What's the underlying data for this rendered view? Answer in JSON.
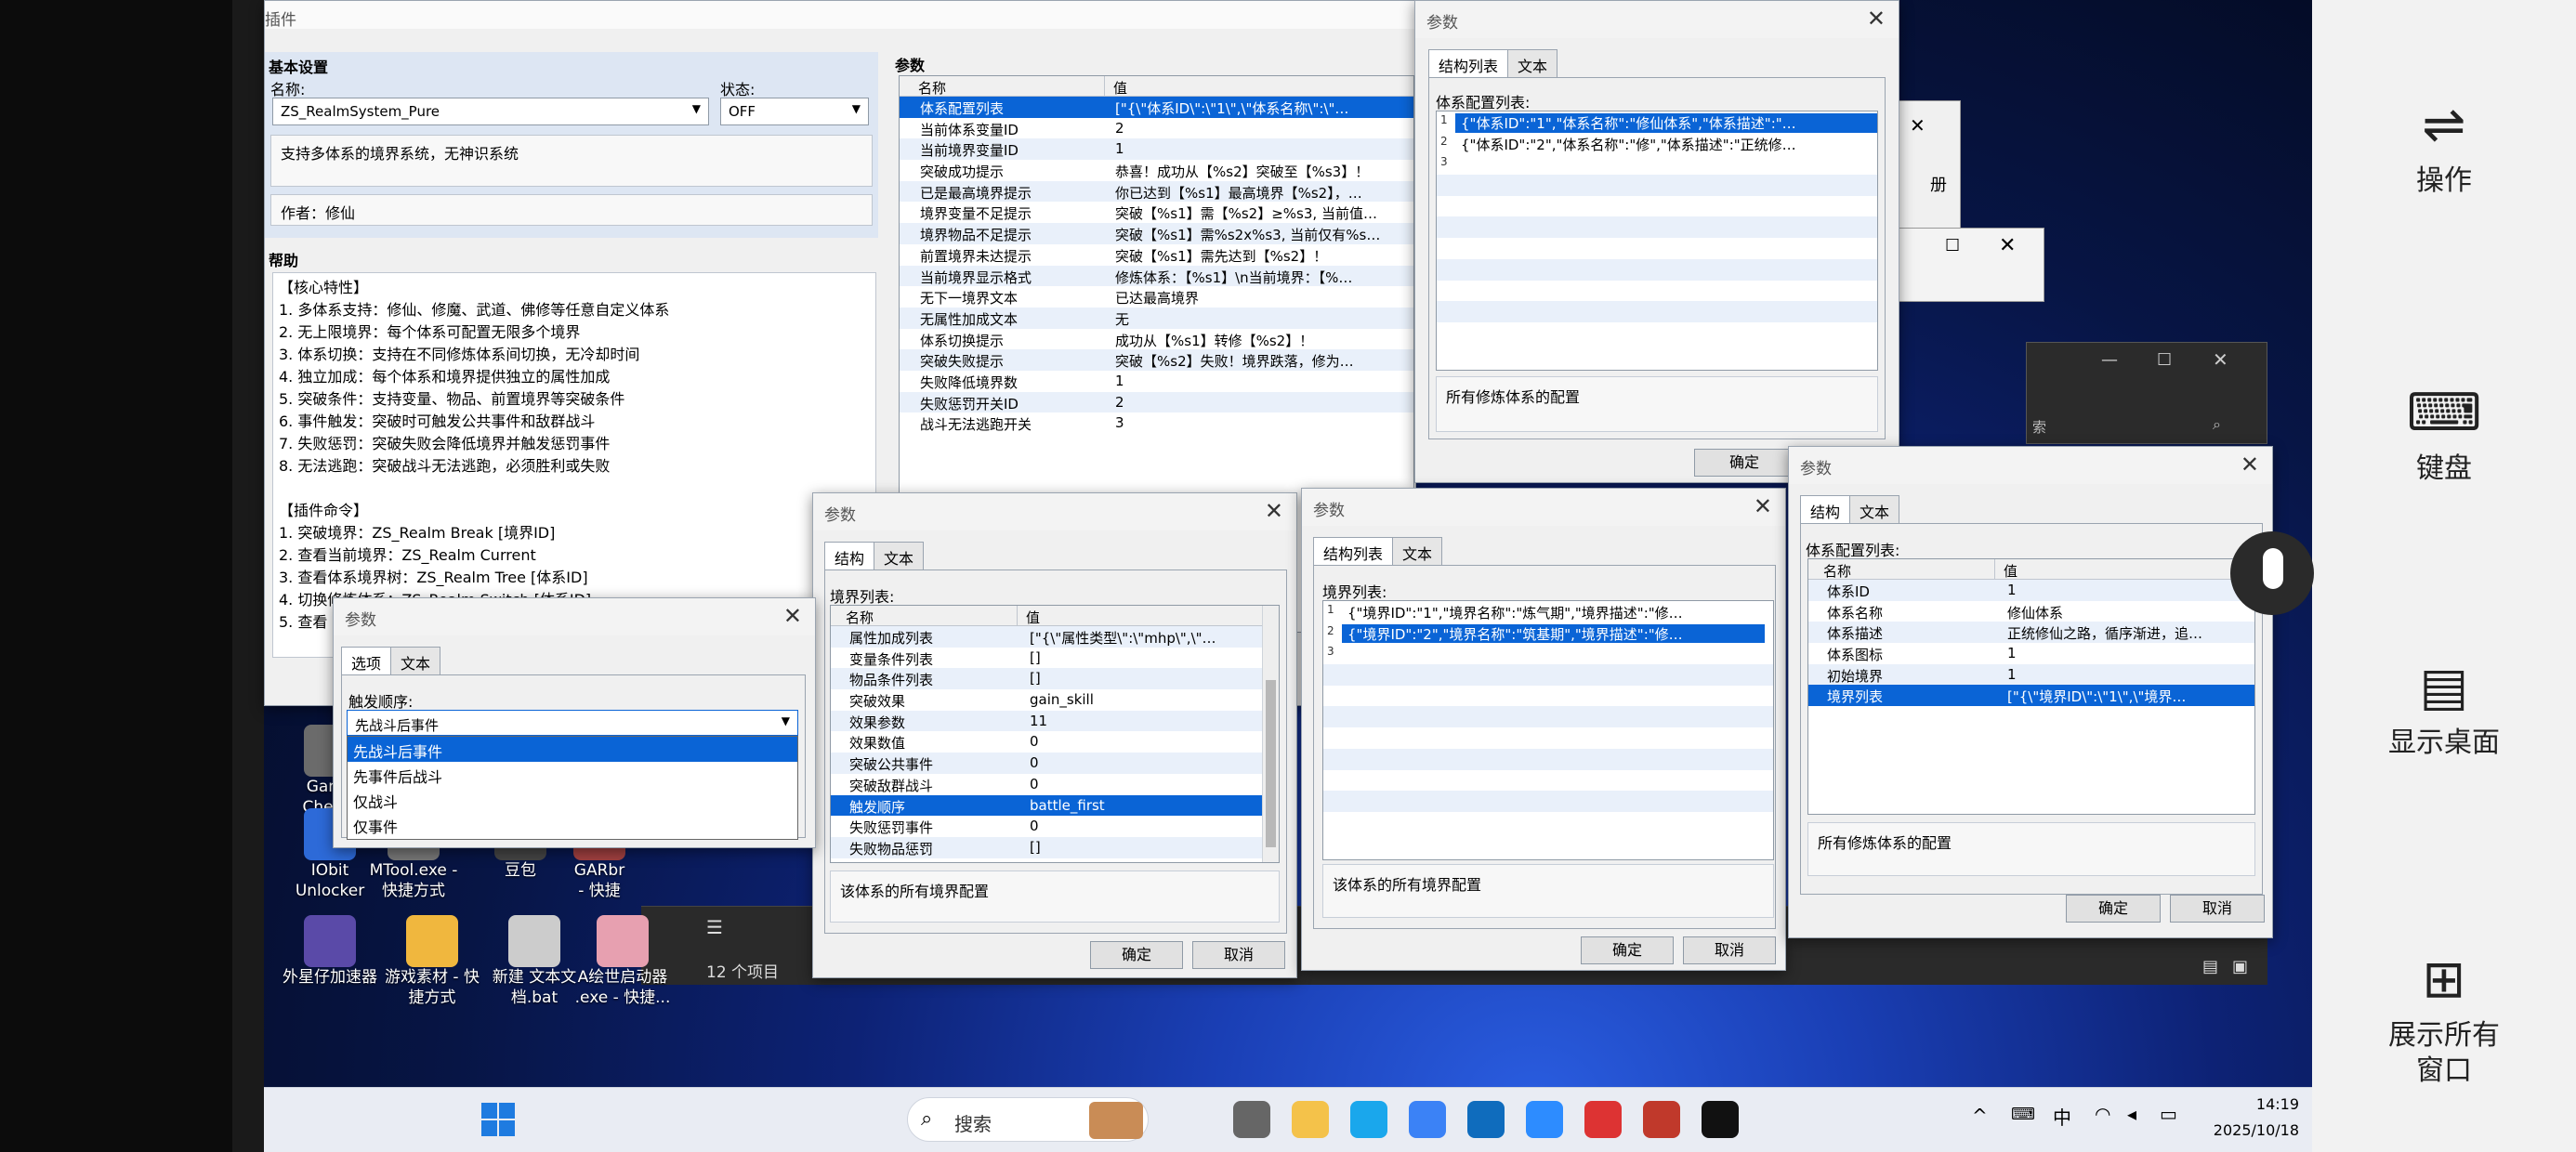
{
  "right_panel": {
    "items": [
      {
        "label": "操作",
        "icon": "toggle-icon"
      },
      {
        "label": "键盘",
        "icon": "keyboard-icon"
      },
      {
        "label": "显示桌面",
        "icon": "desktop-icon"
      },
      {
        "label": "展示所有窗口",
        "icon": "windows-grid-icon"
      }
    ]
  },
  "plugin_window": {
    "title": "插件",
    "basic_settings": "基本设置",
    "name_label": "名称:",
    "name_value": "ZS_RealmSystem_Pure",
    "status_label": "状态:",
    "status_value": "OFF",
    "description": "支持多体系的境界系统，无神识系统",
    "author": "作者：修仙",
    "help_label": "帮助",
    "help_lines": [
      "【核心特性】",
      "1. 多体系支持：修仙、修魔、武道、佛修等任意自定义体系",
      "2. 无上限境界：每个体系可配置无限多个境界",
      "3. 体系切换：支持在不同修炼体系间切换，无冷却时间",
      "4. 独立加成：每个体系和境界提供独立的属性加成",
      "5. 突破条件：支持变量、物品、前置境界等突破条件",
      "6. 事件触发：突破时可触发公共事件和敌群战斗",
      "7. 失败惩罚：突破失败会降低境界并触发惩罚事件",
      "8. 无法逃跑：突破战斗无法逃跑，必须胜利或失败",
      "",
      "【插件命令】",
      "1. 突破境界：ZS_Realm Break [境界ID]",
      "2. 查看当前境界：ZS_Realm Current",
      "3. 查看体系境界树：ZS_Realm Tree [体系ID]",
      "4. 切换修炼体系：ZS_Realm Switch [体系ID]",
      "5. 查看"
    ],
    "params_label": "参数",
    "col_name": "名称",
    "col_value": "值",
    "params": [
      {
        "name": "体系配置列表",
        "value": "[\"{\\\"体系ID\\\":\\\"1\\\",\\\"体系名称\\\":\\\"…",
        "selected": true
      },
      {
        "name": "当前体系变量ID",
        "value": "2"
      },
      {
        "name": "当前境界变量ID",
        "value": "1"
      },
      {
        "name": "突破成功提示",
        "value": "恭喜！成功从【%s2】突破至【%s3】！"
      },
      {
        "name": "已是最高境界提示",
        "value": "你已达到【%s1】最高境界【%s2】，…"
      },
      {
        "name": "境界变量不足提示",
        "value": "突破【%s1】需【%s2】≥%s3, 当前值…"
      },
      {
        "name": "境界物品不足提示",
        "value": "突破【%s1】需%s2x%s3, 当前仅有%s…"
      },
      {
        "name": "前置境界未达提示",
        "value": "突破【%s1】需先达到【%s2】！"
      },
      {
        "name": "当前境界显示格式",
        "value": "修炼体系：【%s1】\\n当前境界：【%…"
      },
      {
        "name": "无下一境界文本",
        "value": "已达最高境界"
      },
      {
        "name": "无属性加成文本",
        "value": "无"
      },
      {
        "name": "体系切换提示",
        "value": "成功从【%s1】转修【%s2】！"
      },
      {
        "name": "突破失败提示",
        "value": "突破【%s2】失败！境界跌落，修为…"
      },
      {
        "name": "失败降低境界数",
        "value": "1"
      },
      {
        "name": "失败惩罚开关ID",
        "value": "2"
      },
      {
        "name": "战斗无法逃跑开关",
        "value": "3"
      }
    ]
  },
  "param_small": {
    "title": "参数",
    "tab_options": "选项",
    "tab_text": "文本",
    "trigger_label": "触发顺序:",
    "selected": "先战斗后事件",
    "options": [
      "先战斗后事件",
      "先事件后战斗",
      "仅战斗",
      "仅事件"
    ]
  },
  "param_realm": {
    "title": "参数",
    "tab_struct": "结构",
    "tab_text": "文本",
    "list_label": "境界列表:",
    "col_name": "名称",
    "col_value": "值",
    "rows": [
      {
        "name": "属性加成列表",
        "value": "[\"{\\\"属性类型\\\":\\\"mhp\\\",\\\"…"
      },
      {
        "name": "变量条件列表",
        "value": "[]"
      },
      {
        "name": "物品条件列表",
        "value": "[]"
      },
      {
        "name": "突破效果",
        "value": "gain_skill"
      },
      {
        "name": "效果参数",
        "value": "11"
      },
      {
        "name": "效果数值",
        "value": "0"
      },
      {
        "name": "突破公共事件",
        "value": "0"
      },
      {
        "name": "突破敌群战斗",
        "value": "0"
      },
      {
        "name": "触发顺序",
        "value": "battle_first",
        "selected": true
      },
      {
        "name": "失败惩罚事件",
        "value": "0"
      },
      {
        "name": "失败物品惩罚",
        "value": "[]"
      }
    ],
    "desc": "该体系的所有境界配置",
    "ok": "确定",
    "cancel": "取消"
  },
  "param_realmlist": {
    "title": "参数",
    "tab_struct": "结构列表",
    "tab_text": "文本",
    "list_label": "境界列表:",
    "rows": [
      {
        "no": "1",
        "value": "{\"境界ID\":\"1\",\"境界名称\":\"炼气期\",\"境界描述\":\"修…"
      },
      {
        "no": "2",
        "value": "{\"境界ID\":\"2\",\"境界名称\":\"筑基期\",\"境界描述\":\"修…",
        "selected": true
      },
      {
        "no": "3",
        "value": ""
      }
    ],
    "desc": "该体系的所有境界配置",
    "ok": "确定",
    "cancel": "取消"
  },
  "param_systemlist": {
    "title": "参数",
    "tab_struct": "结构列表",
    "tab_text": "文本",
    "list_label": "体系配置列表:",
    "rows": [
      {
        "no": "1",
        "value": "{\"体系ID\":\"1\",\"体系名称\":\"修仙体系\",\"体系描述\":\"…",
        "selected": true
      },
      {
        "no": "2",
        "value": "{\"体系ID\":\"2\",\"体系名称\":\"修\",\"体系描述\":\"正统修…"
      },
      {
        "no": "3",
        "value": ""
      }
    ],
    "desc": "所有修炼体系的配置",
    "ok": "确定"
  },
  "param_system": {
    "title": "参数",
    "tab_struct": "结构",
    "tab_text": "文本",
    "list_label": "体系配置列表:",
    "col_name": "名称",
    "col_value": "值",
    "rows": [
      {
        "name": "体系ID",
        "value": "1"
      },
      {
        "name": "体系名称",
        "value": "修仙体系"
      },
      {
        "name": "体系描述",
        "value": "正统修仙之路，循序渐进，追…"
      },
      {
        "name": "体系图标",
        "value": "1"
      },
      {
        "name": "初始境界",
        "value": "1"
      },
      {
        "name": "境界列表",
        "value": "[\"{\\\"境界ID\\\":\\\"1\\\",\\\"境界…",
        "selected": true
      }
    ],
    "desc": "所有修炼体系的配置",
    "ok": "确定",
    "cancel": "取消"
  },
  "background_fragments": {
    "peek_text": "册",
    "search_hint": "索",
    "explorer_count": "12 个项目"
  },
  "desktop_icons": [
    {
      "label": "Game\nCheats",
      "name": "desktop-icon-game-cheats"
    },
    {
      "label": "IObit\nUnlocker",
      "name": "desktop-icon-iobit"
    },
    {
      "label": "MTool.exe -\n快捷方式",
      "name": "desktop-icon-mtool"
    },
    {
      "label": "豆包",
      "name": "desktop-icon-doubao"
    },
    {
      "label": "GARbr\n- 快捷",
      "name": "desktop-icon-garbro"
    },
    {
      "label": "外星仔加速器",
      "name": "desktop-icon-accelerator"
    },
    {
      "label": "游戏素材 - 快\n捷方式",
      "name": "desktop-icon-game-assets"
    },
    {
      "label": "新建 文本文\n档.bat",
      "name": "desktop-icon-bat"
    },
    {
      "label": "A绘世启动器\n.exe - 快捷...",
      "name": "desktop-icon-launcher"
    }
  ],
  "taskbar": {
    "search": "搜索",
    "ime": "中",
    "time": "14:19",
    "date": "2025/10/18"
  }
}
